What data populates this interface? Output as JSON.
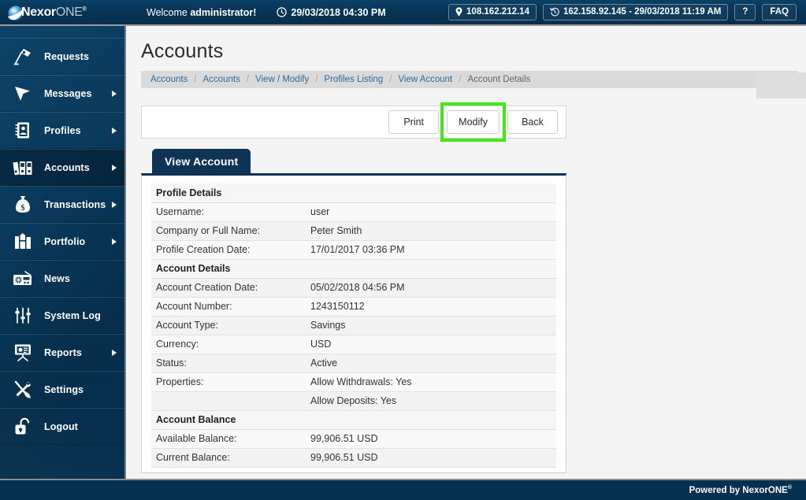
{
  "brand": {
    "logo_main": "Nexor",
    "logo_secondary": "ONE",
    "logo_registered": "®",
    "logo_icon": "sphere-swoosh-logo"
  },
  "header": {
    "welcome_prefix": "Welcome ",
    "welcome_user": "administrator!",
    "clock_icon": "clock-icon",
    "datetime": "29/03/2018 04:30 PM",
    "location_icon": "location-pin-icon",
    "current_ip": "108.162.212.14",
    "history_icon": "history-clock-icon",
    "last_login": "162.158.92.145 - 29/03/2018 11:19 AM",
    "help_label": "?",
    "faq_label": "FAQ"
  },
  "sidebar": {
    "items": [
      {
        "label": "Requests",
        "icon": "desk-lamp-icon",
        "arrow": false,
        "active": false
      },
      {
        "label": "Messages",
        "icon": "cursor-arrow-icon",
        "arrow": true,
        "active": false
      },
      {
        "label": "Profiles",
        "icon": "address-book-icon",
        "arrow": true,
        "active": false
      },
      {
        "label": "Accounts",
        "icon": "binders-icon",
        "arrow": true,
        "active": true
      },
      {
        "label": "Transactions",
        "icon": "money-bag-icon",
        "arrow": true,
        "active": false
      },
      {
        "label": "Portfolio",
        "icon": "briefcase-icon",
        "arrow": true,
        "active": false
      },
      {
        "label": "News",
        "icon": "radio-icon",
        "arrow": false,
        "active": false
      },
      {
        "label": "System Log",
        "icon": "sliders-icon",
        "arrow": false,
        "active": false
      },
      {
        "label": "Reports",
        "icon": "presentation-icon",
        "arrow": true,
        "active": false
      },
      {
        "label": "Settings",
        "icon": "tools-icon",
        "arrow": false,
        "active": false
      },
      {
        "label": "Logout",
        "icon": "padlock-open-icon",
        "arrow": false,
        "active": false
      }
    ]
  },
  "main": {
    "page_title": "Accounts",
    "breadcrumb": [
      {
        "label": "Accounts",
        "link": true
      },
      {
        "label": "Accounts",
        "link": true
      },
      {
        "label": "View / Modify",
        "link": true
      },
      {
        "label": "Profiles Listing",
        "link": true
      },
      {
        "label": "View Account",
        "link": true
      },
      {
        "label": "Account Details",
        "link": false
      }
    ],
    "breadcrumb_separator": "/",
    "toolbar": {
      "print_label": "Print",
      "modify_label": "Modify",
      "back_label": "Back",
      "highlight_color": "#44e618",
      "highlighted_button": "modify"
    },
    "tab_label": "View Account",
    "sections": [
      {
        "heading": "Profile Details",
        "rows": [
          {
            "label": "Username:",
            "value": "user"
          },
          {
            "label": "Company or Full Name:",
            "value": "Peter Smith"
          },
          {
            "label": "Profile Creation Date:",
            "value": "17/01/2017 03:36 PM"
          }
        ]
      },
      {
        "heading": "Account Details",
        "rows": [
          {
            "label": "Account Creation Date:",
            "value": "05/02/2018 04:56 PM"
          },
          {
            "label": "Account Number:",
            "value": "1243150112"
          },
          {
            "label": "Account Type:",
            "value": "Savings"
          },
          {
            "label": "Currency:",
            "value": "USD"
          },
          {
            "label": "Status:",
            "value": "Active"
          },
          {
            "label": "Properties:",
            "value": "Allow Withdrawals:  Yes"
          },
          {
            "label": "",
            "value": "Allow Deposits:  Yes"
          }
        ]
      },
      {
        "heading": "Account Balance",
        "rows": [
          {
            "label": "Available Balance:",
            "value": "99,906.51 USD"
          },
          {
            "label": "Current Balance:",
            "value": "99,906.51 USD"
          }
        ]
      }
    ]
  },
  "footer": {
    "powered_by": "Powered by NexorONE",
    "registered": "®"
  },
  "colors": {
    "header_navy": "#06304f",
    "sidebar_navy": "#0a3a5c",
    "tab_navy": "#0e3354",
    "link_blue": "#2d6ca2",
    "breadcrumb_bg": "#dadada",
    "page_bg": "#f4f4f4",
    "highlight_green": "#44e618"
  }
}
